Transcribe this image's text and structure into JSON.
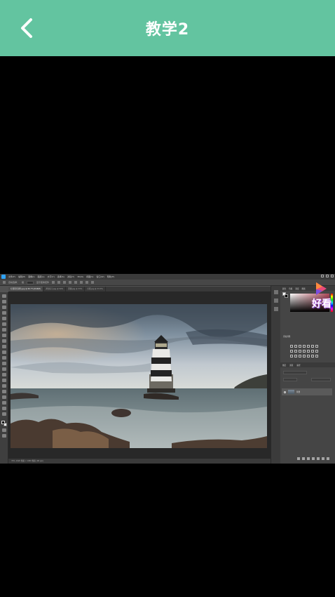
{
  "header": {
    "title": "教学2",
    "background_color": "#63c4a0",
    "back_icon": "chevron-left-icon"
  },
  "video": {
    "ps_app": {
      "menu": [
        "文件(F)",
        "编辑(E)",
        "图像(I)",
        "图层(L)",
        "文字(Y)",
        "选择(S)",
        "滤镜(T)",
        "3D(D)",
        "视图(V)",
        "窗口(W)",
        "帮助(H)"
      ],
      "options": {
        "auto_select_label": "自动选择：",
        "auto_select_value": "组",
        "transform_label": "显示变换控件"
      },
      "tabs": [
        "灯塔风光调色.jpg @ 66.7%(RGB/8)",
        "调色练习.jpg @ 50%",
        "原图.jpg @ 33%",
        "灯塔.jpg @ 33.3%"
      ],
      "status_text": "79%   1920 像素 x 1080 像素 (96 ppi)",
      "panels": {
        "color_tabs": [
          "颜色",
          "色板",
          "渐变",
          "图案"
        ],
        "adjustments_title": "添加调整",
        "layers_tabs": [
          "图层",
          "通道",
          "路径"
        ],
        "layer_name": "背景"
      }
    },
    "watermark_text": "好看"
  }
}
